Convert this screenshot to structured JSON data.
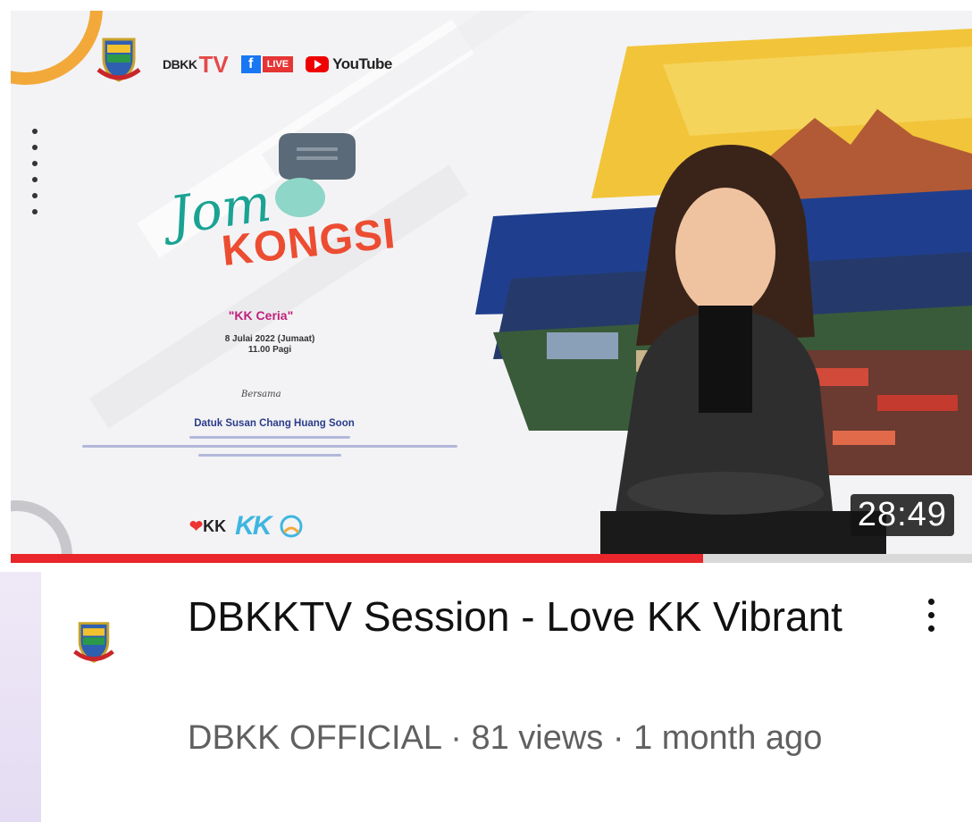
{
  "thumbnail": {
    "brand": {
      "dbkk": "DBKK",
      "tv": "TV",
      "fb_live": "LIVE",
      "youtube": "YouTube"
    },
    "show_script": "Jom",
    "show_title": "KONGSI",
    "episode_title": "\"KK Ceria\"",
    "date_line1": "8 Julai 2022 (Jumaat)",
    "date_line2": "11.00 Pagi",
    "with_label": "Bersama",
    "guest_name": "Datuk Susan Chang Huang Soon",
    "bottom_logo_love": "KK",
    "bottom_logo_kk": "KK",
    "duration": "28:49",
    "watch_progress": 0.72
  },
  "video": {
    "title": "DBKKTV Session - Love KK Vibrant",
    "channel": "DBKK OFFICIAL",
    "views": "81 views",
    "age": "1 month ago",
    "separator": "·"
  },
  "icons": {
    "avatar": "dbkk-crest-icon",
    "menu": "more-vert-icon"
  },
  "colors": {
    "progress": "#e8262b",
    "title": "#111111",
    "meta": "#606060"
  }
}
